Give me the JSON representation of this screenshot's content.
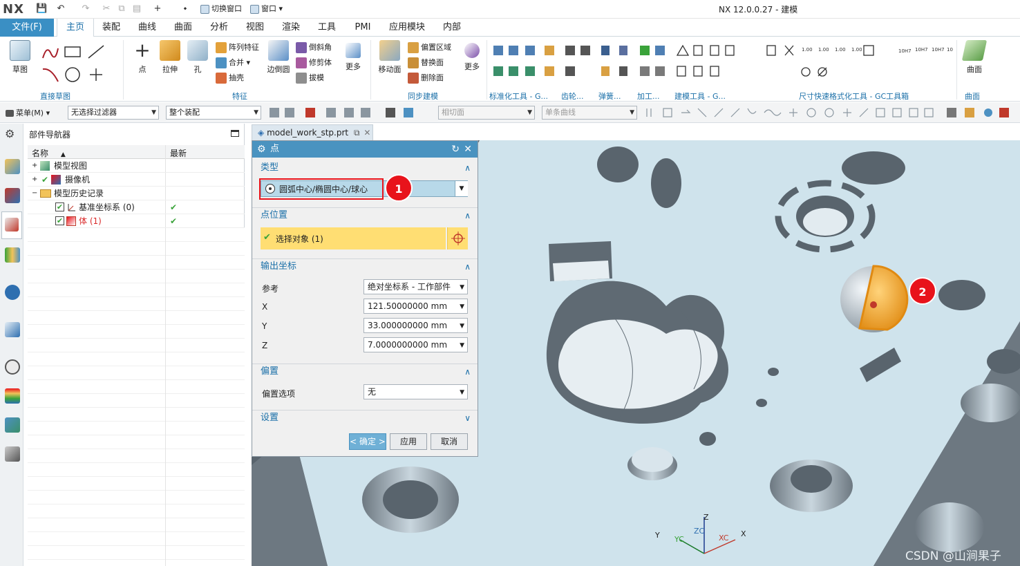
{
  "app": {
    "logo": "NX",
    "title": "NX 12.0.0.27 - 建模",
    "quick_access": {
      "switch_window": "切换窗口",
      "window": "窗口"
    }
  },
  "menu_tabs": [
    "文件(F)",
    "主页",
    "装配",
    "曲线",
    "曲面",
    "分析",
    "视图",
    "渲染",
    "工具",
    "PMI",
    "应用模块",
    "内部"
  ],
  "ribbon": {
    "sketch": "草图",
    "direct_sketch_group": "直接草图",
    "point": "点",
    "extrude": "拉伸",
    "hole": "孔",
    "pattern_feature": "阵列特征",
    "unite": "合并",
    "shell": "抽壳",
    "draft": "边倒圆",
    "chamfer": "倒斜角",
    "trim_body": "修剪体",
    "taper": "拔模",
    "more1": "更多",
    "feature_group": "特征",
    "move_face": "移动面",
    "offset_region": "偏置区域",
    "replace_face": "替换面",
    "delete_face": "删除面",
    "more2": "更多",
    "sync_group": "同步建模",
    "std_tools_group": "标准化工具 - G...",
    "gear_group": "齿轮...",
    "spring_group": "弹簧...",
    "machining_group": "加工...",
    "modeling_tools_group": "建模工具 - G...",
    "dim_tools_group": "尺寸快速格式化工具 - GC工具箱",
    "surface": "曲面",
    "surface_group": "曲面"
  },
  "selection_bar": {
    "menu": "菜单(M)",
    "filter": "无选择过滤器",
    "scope": "整个装配",
    "face_rule": "相切面",
    "curve_rule": "单条曲线"
  },
  "navigator": {
    "title": "部件导航器",
    "col_name": "名称",
    "col_latest": "最新",
    "rows": [
      {
        "label": "模型视图",
        "latest": ""
      },
      {
        "label": "摄像机",
        "latest": ""
      },
      {
        "label": "模型历史记录",
        "latest": ""
      },
      {
        "label": "基准坐标系 (0)",
        "latest": "✔"
      },
      {
        "label": "体 (1)",
        "latest": "✔"
      }
    ]
  },
  "document_tab": "model_work_stp.prt",
  "dialog": {
    "title": "点",
    "type_section": "类型",
    "type_value": "圆弧中心/椭圆中心/球心",
    "point_location_section": "点位置",
    "select_object": "选择对象 (1)",
    "output_section": "输出坐标",
    "reference_label": "参考",
    "reference_value": "绝对坐标系 - 工作部件",
    "x_label": "X",
    "x_value": "121.50000000",
    "y_label": "Y",
    "y_value": "33.000000000",
    "z_label": "Z",
    "z_value": "7.0000000000",
    "unit": "mm",
    "offset_section": "偏置",
    "offset_option_label": "偏置选项",
    "offset_option_value": "无",
    "settings_section": "设置",
    "ok": "< 确定 >",
    "apply": "应用",
    "cancel": "取消"
  },
  "annotations": {
    "badge1": "1",
    "badge2": "2"
  },
  "triad": {
    "y": "Y",
    "yc": "YC",
    "zc": "ZC",
    "z": "Z",
    "xc": "XC",
    "x": "X"
  },
  "watermark": "CSDN @山涧果子",
  "colors": {
    "accent": "#4a93c0",
    "file_tab": "#3a8fc4",
    "highlight": "#ffde73",
    "badge": "#e8131b",
    "model_face": "#cfe3ec",
    "model_side": "#697680"
  }
}
